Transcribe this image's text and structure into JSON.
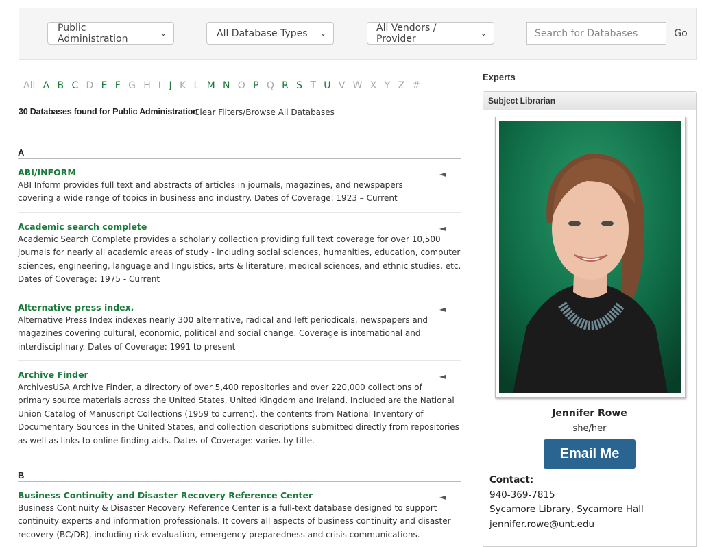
{
  "filters": {
    "subject": "Public Administration",
    "type": "All Database Types",
    "vendor": "All Vendors / Provider",
    "search_placeholder": "Search for Databases",
    "go_label": "Go"
  },
  "alphabet": [
    {
      "ch": "All",
      "on": false
    },
    {
      "ch": "A",
      "on": true
    },
    {
      "ch": "B",
      "on": true
    },
    {
      "ch": "C",
      "on": true
    },
    {
      "ch": "D",
      "on": false
    },
    {
      "ch": "E",
      "on": true
    },
    {
      "ch": "F",
      "on": true
    },
    {
      "ch": "G",
      "on": false
    },
    {
      "ch": "H",
      "on": false
    },
    {
      "ch": "I",
      "on": true
    },
    {
      "ch": "J",
      "on": true
    },
    {
      "ch": "K",
      "on": false
    },
    {
      "ch": "L",
      "on": false
    },
    {
      "ch": "M",
      "on": true
    },
    {
      "ch": "N",
      "on": true
    },
    {
      "ch": "O",
      "on": false
    },
    {
      "ch": "P",
      "on": true
    },
    {
      "ch": "Q",
      "on": false
    },
    {
      "ch": "R",
      "on": true
    },
    {
      "ch": "S",
      "on": true
    },
    {
      "ch": "T",
      "on": true
    },
    {
      "ch": "U",
      "on": true
    },
    {
      "ch": "V",
      "on": false
    },
    {
      "ch": "W",
      "on": false
    },
    {
      "ch": "X",
      "on": false
    },
    {
      "ch": "Y",
      "on": false
    },
    {
      "ch": "Z",
      "on": false
    },
    {
      "ch": "#",
      "on": false
    }
  ],
  "results": {
    "count_text": "30 Databases found for Public Administration",
    "clear_text": "Clear Filters/Browse All Databases"
  },
  "groups": [
    {
      "letter": "A",
      "entries": [
        {
          "title": "ABI/INFORM",
          "lines": [
            "ABI Inform provides full text and abstracts of articles in journals, magazines, and newspapers",
            "covering a wide range of topics in business and industry. Dates of Coverage: 1923 – Current"
          ]
        },
        {
          "title": "Academic search complete",
          "lines": [
            "Academic Search Complete provides a scholarly collection providing full text coverage for over 10,500",
            "journals for nearly all academic areas of study - including social sciences, humanities, education, computer",
            "sciences, engineering, language and linguistics, arts & literature, medical sciences, and ethnic studies, etc.",
            "Dates of Coverage: 1975 - Current"
          ]
        },
        {
          "title": "Alternative press index.",
          "lines": [
            "Alternative Press Index indexes nearly 300 alternative, radical and left periodicals, newspapers and",
            "magazines covering cultural, economic, political and social change. Coverage is international and",
            "interdisciplinary. Dates of Coverage: 1991 to present"
          ]
        },
        {
          "title": "Archive Finder",
          "lines": [
            "ArchivesUSA Archive Finder, a directory of over 5,400 repositories and over 220,000 collections of",
            "primary source materials across the United States, United Kingdom and Ireland. Included are the National",
            "Union Catalog of Manuscript Collections (1959 to current), the contents from National Inventory of",
            "Documentary Sources in the United States, and collection descriptions submitted directly from repositories",
            "as well as links to online finding aids. Dates of Coverage: varies by title."
          ]
        }
      ]
    },
    {
      "letter": "B",
      "entries": [
        {
          "title": "Business Continuity and Disaster Recovery Reference Center",
          "lines": [
            "Business Continuity & Disaster Recovery Reference Center is a full-text database designed to support",
            "continuity experts and information professionals. It covers all aspects of business continuity and disaster",
            "recovery (BC/DR), including risk evaluation, emergency preparedness and crisis communications."
          ]
        }
      ]
    }
  ],
  "experts": {
    "heading": "Experts",
    "box_title": "Subject Librarian",
    "name": "Jennifer Rowe",
    "pronouns": "she/her",
    "email_button": "Email Me",
    "contact_label": "Contact:",
    "phone": "940-369-7815",
    "location": "Sycamore Library, Sycamore Hall",
    "email": "jennifer.rowe@unt.edu"
  },
  "icons": {
    "share": "share-icon",
    "dropdown": "chevron-down-icon"
  },
  "colors": {
    "link_green": "#1a7a3a",
    "button_blue": "#2a6592",
    "photo_bg": "#0e6a45"
  }
}
